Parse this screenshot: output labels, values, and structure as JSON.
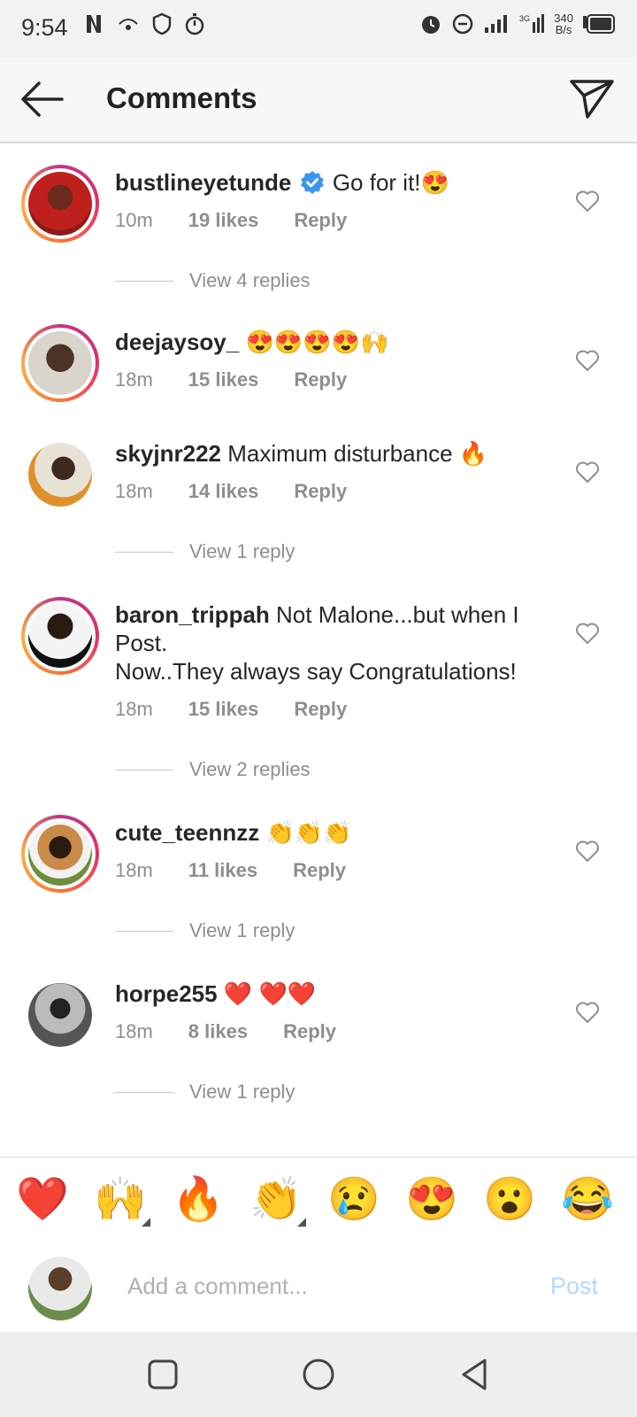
{
  "status": {
    "time": "9:54",
    "net_speed_top": "340",
    "net_speed_bottom": "B/s"
  },
  "header": {
    "title": "Comments"
  },
  "comments": [
    {
      "username": "bustlineyetunde",
      "verified": true,
      "text": "Go for it!😍",
      "time": "10m",
      "likes": "19 likes",
      "reply": "Reply",
      "view_replies": "View 4 replies",
      "ring": true
    },
    {
      "username": "deejaysoy_",
      "text": "😍😍😍😍🙌",
      "time": "18m",
      "likes": "15 likes",
      "reply": "Reply",
      "ring": true
    },
    {
      "username": "skyjnr222",
      "text": "Maximum disturbance 🔥",
      "time": "18m",
      "likes": "14 likes",
      "reply": "Reply",
      "view_replies": "View 1 reply",
      "ring": false
    },
    {
      "username": "baron_trippah",
      "text": "Not Malone...but when I Post.\nNow..They always say Congratulations!",
      "time": "18m",
      "likes": "15 likes",
      "reply": "Reply",
      "view_replies": "View 2 replies",
      "ring": true
    },
    {
      "username": "cute_teennzz",
      "text": "👏👏👏",
      "time": "18m",
      "likes": "11 likes",
      "reply": "Reply",
      "view_replies": "View 1 reply",
      "ring": true
    },
    {
      "username": "horpe255",
      "text": "❤️ ❤️❤️",
      "time": "18m",
      "likes": "8 likes",
      "reply": "Reply",
      "view_replies": "View 1 reply",
      "ring": false
    }
  ],
  "quick_emojis": [
    "❤️",
    "🙌",
    "🔥",
    "👏",
    "😢",
    "😍",
    "😮",
    "😂"
  ],
  "compose": {
    "placeholder": "Add a comment...",
    "post_label": "Post"
  },
  "colors": {
    "link_disabled": "#b3d9fb",
    "verified_badge": "#3897f0",
    "muted_text": "#8e8e8e"
  }
}
